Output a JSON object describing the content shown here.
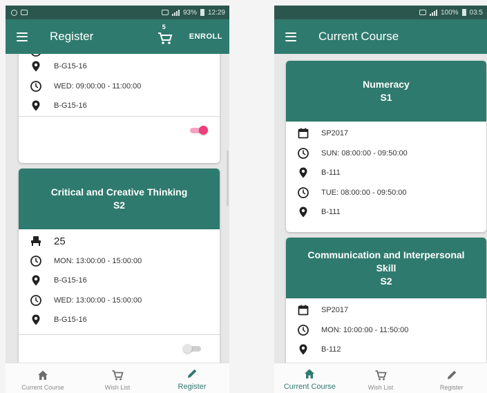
{
  "colors": {
    "primary": "#2f7a6e",
    "statusbar": "#2b564d",
    "toggle_on": "#ea3f7c",
    "icon": "#222222"
  },
  "left": {
    "status": {
      "battery": "93%",
      "time": "12:29"
    },
    "appbar": {
      "title": "Register",
      "cart_count": "5",
      "enroll_label": "ENROLL",
      "menu_icon": "menu-icon",
      "cart_icon": "cart-icon"
    },
    "card1": {
      "rows": [
        {
          "icon": "location-icon",
          "text": "B-G15-16"
        },
        {
          "icon": "clock-icon",
          "text": "WED: 09:00:00 - 11:00:00"
        },
        {
          "icon": "location-icon",
          "text": "B-G15-16"
        }
      ],
      "toggle_on": true
    },
    "card2": {
      "title": "Critical and Creative Thinking",
      "semester": "S2",
      "seats": "25",
      "rows": [
        {
          "icon": "clock-icon",
          "text": "MON: 13:00:00 - 15:00:00"
        },
        {
          "icon": "location-icon",
          "text": "B-G15-16"
        },
        {
          "icon": "clock-icon",
          "text": "WED: 13:00:00 - 15:00:00"
        },
        {
          "icon": "location-icon",
          "text": "B-G15-16"
        }
      ],
      "toggle_on": false
    },
    "nav": [
      {
        "icon": "home-icon",
        "label": "Current Course"
      },
      {
        "icon": "cart-icon",
        "label": "Wish List"
      },
      {
        "icon": "pencil-icon",
        "label": "Register"
      }
    ],
    "active_nav": "Register"
  },
  "right": {
    "status": {
      "battery": "100%",
      "time": "03:5"
    },
    "appbar": {
      "title": "Current Course",
      "menu_icon": "menu-icon"
    },
    "card1": {
      "title": "Numeracy",
      "semester": "S1",
      "rows": [
        {
          "icon": "calendar-icon",
          "text": "SP2017"
        },
        {
          "icon": "clock-icon",
          "text": "SUN: 08:00:00 - 09:50:00"
        },
        {
          "icon": "location-icon",
          "text": "B-111"
        },
        {
          "icon": "clock-icon",
          "text": "TUE: 08:00:00 - 09:50:00"
        },
        {
          "icon": "location-icon",
          "text": "B-111"
        }
      ]
    },
    "card2": {
      "title_line1": "Communication and Interpersonal",
      "title_line2": "Skill",
      "semester": "S2",
      "rows": [
        {
          "icon": "calendar-icon",
          "text": "SP2017"
        },
        {
          "icon": "clock-icon",
          "text": "MON: 10:00:00 - 11:50:00"
        },
        {
          "icon": "location-icon",
          "text": "B-112"
        }
      ]
    },
    "nav": [
      {
        "icon": "home-icon",
        "label": "Current Course"
      },
      {
        "icon": "cart-icon",
        "label": "Wish List"
      },
      {
        "icon": "pencil-icon",
        "label": "Register"
      }
    ],
    "active_nav": "Current Course"
  }
}
